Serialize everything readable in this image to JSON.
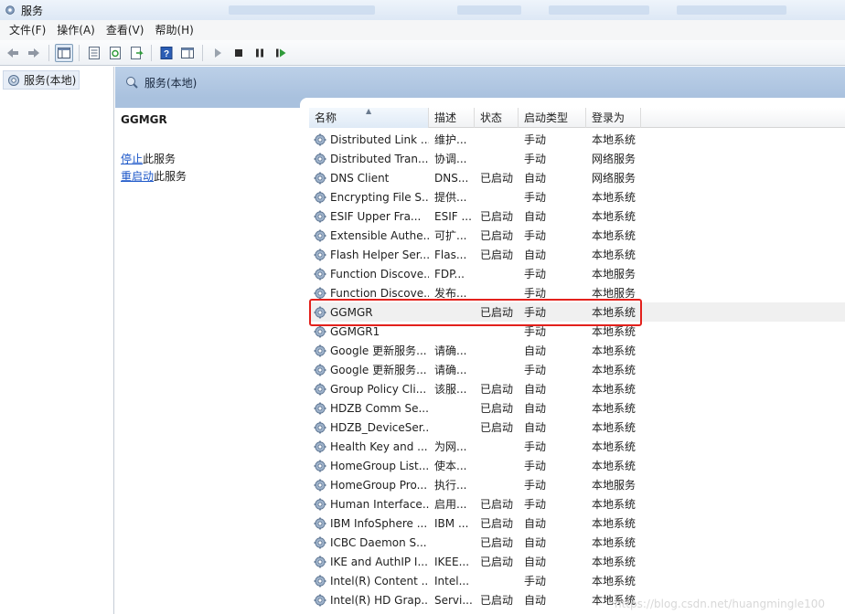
{
  "window": {
    "title": "服务"
  },
  "menu": [
    "文件(F)",
    "操作(A)",
    "查看(V)",
    "帮助(H)"
  ],
  "tree": {
    "item": "服务(本地)"
  },
  "pane": {
    "header_title": "服务(本地)"
  },
  "detail": {
    "service_name": "GGMGR",
    "stop_link": "停止",
    "stop_suffix": "此服务",
    "restart_link": "重启动",
    "restart_suffix": "此服务"
  },
  "columns": {
    "name": "名称",
    "desc": "描述",
    "status": "状态",
    "startup": "启动类型",
    "logon": "登录为"
  },
  "rows": [
    {
      "name": "Distributed Link ...",
      "desc": "维护...",
      "status": "",
      "startup": "手动",
      "logon": "本地系统"
    },
    {
      "name": "Distributed Tran...",
      "desc": "协调...",
      "status": "",
      "startup": "手动",
      "logon": "网络服务"
    },
    {
      "name": "DNS Client",
      "desc": "DNS...",
      "status": "已启动",
      "startup": "自动",
      "logon": "网络服务"
    },
    {
      "name": "Encrypting File S...",
      "desc": "提供...",
      "status": "",
      "startup": "手动",
      "logon": "本地系统"
    },
    {
      "name": "ESIF Upper Fra...",
      "desc": "ESIF ...",
      "status": "已启动",
      "startup": "自动",
      "logon": "本地系统"
    },
    {
      "name": "Extensible Authe...",
      "desc": "可扩...",
      "status": "已启动",
      "startup": "手动",
      "logon": "本地系统"
    },
    {
      "name": "Flash Helper Ser...",
      "desc": "Flas...",
      "status": "已启动",
      "startup": "自动",
      "logon": "本地系统"
    },
    {
      "name": "Function Discove...",
      "desc": "FDP...",
      "status": "",
      "startup": "手动",
      "logon": "本地服务"
    },
    {
      "name": "Function Discove...",
      "desc": "发布...",
      "status": "",
      "startup": "手动",
      "logon": "本地服务"
    },
    {
      "name": "GGMGR",
      "desc": "",
      "status": "已启动",
      "startup": "手动",
      "logon": "本地系统"
    },
    {
      "name": "GGMGR1",
      "desc": "",
      "status": "",
      "startup": "手动",
      "logon": "本地系统"
    },
    {
      "name": "Google 更新服务...",
      "desc": "请确...",
      "status": "",
      "startup": "自动",
      "logon": "本地系统"
    },
    {
      "name": "Google 更新服务...",
      "desc": "请确...",
      "status": "",
      "startup": "手动",
      "logon": "本地系统"
    },
    {
      "name": "Group Policy Cli...",
      "desc": "该服...",
      "status": "已启动",
      "startup": "自动",
      "logon": "本地系统"
    },
    {
      "name": "HDZB Comm Se...",
      "desc": "",
      "status": "已启动",
      "startup": "自动",
      "logon": "本地系统"
    },
    {
      "name": "HDZB_DeviceSer...",
      "desc": "",
      "status": "已启动",
      "startup": "自动",
      "logon": "本地系统"
    },
    {
      "name": "Health Key and ...",
      "desc": "为网...",
      "status": "",
      "startup": "手动",
      "logon": "本地系统"
    },
    {
      "name": "HomeGroup List...",
      "desc": "使本...",
      "status": "",
      "startup": "手动",
      "logon": "本地系统"
    },
    {
      "name": "HomeGroup Pro...",
      "desc": "执行...",
      "status": "",
      "startup": "手动",
      "logon": "本地服务"
    },
    {
      "name": "Human Interface...",
      "desc": "启用...",
      "status": "已启动",
      "startup": "手动",
      "logon": "本地系统"
    },
    {
      "name": "IBM InfoSphere ...",
      "desc": "IBM ...",
      "status": "已启动",
      "startup": "自动",
      "logon": "本地系统"
    },
    {
      "name": "ICBC Daemon S...",
      "desc": "",
      "status": "已启动",
      "startup": "自动",
      "logon": "本地系统"
    },
    {
      "name": "IKE and AuthIP I...",
      "desc": "IKEE...",
      "status": "已启动",
      "startup": "自动",
      "logon": "本地系统"
    },
    {
      "name": "Intel(R) Content ...",
      "desc": "Intel...",
      "status": "",
      "startup": "手动",
      "logon": "本地系统"
    },
    {
      "name": "Intel(R) HD Grap...",
      "desc": "Servi...",
      "status": "已启动",
      "startup": "自动",
      "logon": "本地系统"
    }
  ],
  "selected_row": "GGMGR",
  "watermark": "https://blog.csdn.net/huangmingle100"
}
